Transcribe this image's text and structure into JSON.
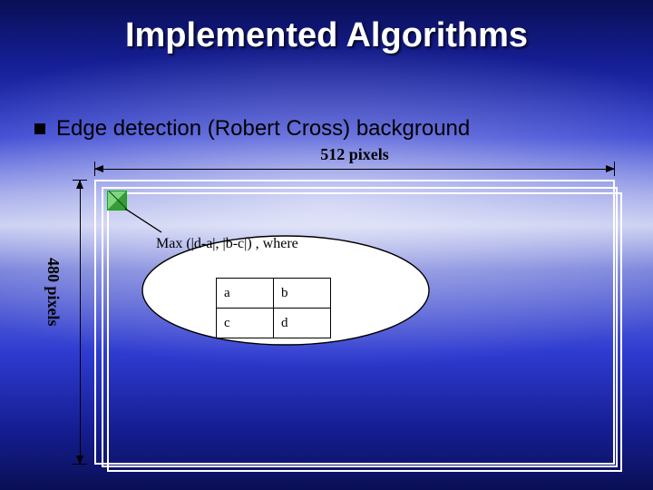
{
  "title": "Implemented Algorithms",
  "bullet": "Edge detection (Robert Cross) background",
  "dims": {
    "width": "512 pixels",
    "height": "480 pixels"
  },
  "bubble": {
    "formula": "Max (|d-a|, |b-c|) , where"
  },
  "grid": {
    "a": "a",
    "b": "b",
    "c": "c",
    "d": "d"
  }
}
